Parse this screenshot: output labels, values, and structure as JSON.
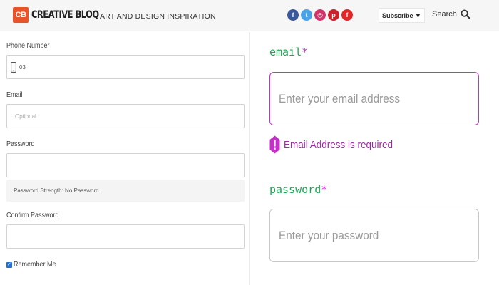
{
  "header": {
    "logo_mark": "CB",
    "logo_text": "CREATIVE BLOQ",
    "tagline": "ART AND DESIGN INSPIRATION",
    "social_icons": [
      {
        "name": "facebook-icon",
        "glyph": "f",
        "color": "#3b5998"
      },
      {
        "name": "twitter-icon",
        "glyph": "t",
        "color": "#4aa3e8"
      },
      {
        "name": "instagram-icon",
        "glyph": "◎",
        "color": "#d6336c"
      },
      {
        "name": "pinterest-icon",
        "glyph": "p",
        "color": "#c8232c"
      },
      {
        "name": "flipboard-icon",
        "glyph": "f",
        "color": "#e12828"
      }
    ],
    "subscribe_label": "Subscribe ▼",
    "search_label": "Search"
  },
  "left_form": {
    "phone": {
      "label": "Phone Number",
      "value": "03"
    },
    "email": {
      "label": "Email",
      "placeholder": "Optional"
    },
    "password": {
      "label": "Password",
      "value": ""
    },
    "strength_text": "Password Strength: No Password",
    "confirm": {
      "label": "Confirm Password",
      "value": ""
    },
    "remember": {
      "label": "Remember Me",
      "checked": true
    }
  },
  "right_form": {
    "email": {
      "label": "email",
      "required_mark": "*",
      "placeholder": "Enter your email address"
    },
    "error": {
      "icon_glyph": "!",
      "text": "Email Address is required"
    },
    "password": {
      "label": "password",
      "required_mark": "*",
      "placeholder": "Enter your password"
    }
  },
  "colors": {
    "accent_green": "#19a852",
    "error_magenta": "#c431c9",
    "brand_orange": "#e8542a"
  }
}
